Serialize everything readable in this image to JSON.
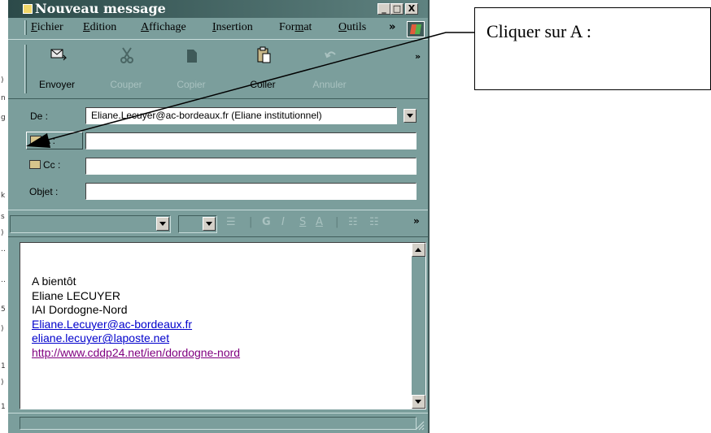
{
  "window": {
    "title": "Nouveau message",
    "controls": {
      "minimize": "_",
      "maximize": "□",
      "close": "X"
    }
  },
  "menubar": {
    "items": [
      {
        "label": "Fichier",
        "mnemonic": "F"
      },
      {
        "label": "Edition",
        "mnemonic": "E"
      },
      {
        "label": "Affichage",
        "mnemonic": "A"
      },
      {
        "label": "Insertion",
        "mnemonic": "I"
      },
      {
        "label": "Format",
        "mnemonic": "m"
      },
      {
        "label": "Outils",
        "mnemonic": "O"
      }
    ],
    "overflow": "»"
  },
  "toolbar": {
    "buttons": [
      {
        "label": "Envoyer",
        "icon": "send-icon",
        "enabled": true
      },
      {
        "label": "Couper",
        "icon": "scissors-icon",
        "enabled": false
      },
      {
        "label": "Copier",
        "icon": "copy-icon",
        "enabled": false
      },
      {
        "label": "Coller",
        "icon": "paste-icon",
        "enabled": true
      },
      {
        "label": "Annuler",
        "icon": "undo-icon",
        "enabled": false
      }
    ],
    "overflow": "»"
  },
  "header": {
    "from_label": "De :",
    "from_value": "Eliane.Lecuyer@ac-bordeaux.fr    (Eliane institutionnel)",
    "to_label": "A :",
    "to_value": "",
    "cc_label": "Cc :",
    "cc_value": "",
    "subject_label": "Objet :",
    "subject_value": ""
  },
  "format_toolbar": {
    "font_name": "",
    "font_size": "",
    "overflow": "»",
    "icons": [
      "paragraph-style-icon",
      "bold-icon",
      "italic-icon",
      "underline-icon",
      "font-color-icon",
      "numbered-list-icon",
      "bullet-list-icon"
    ]
  },
  "message_body": {
    "lines": [
      {
        "text": "A bientôt",
        "kind": "text"
      },
      {
        "text": "Eliane LECUYER",
        "kind": "text"
      },
      {
        "text": "IAI Dordogne-Nord",
        "kind": "text"
      },
      {
        "text": "Eliane.Lecuyer@ac-bordeaux.fr",
        "kind": "link"
      },
      {
        "text": "eliane.lecuyer@laposte.net",
        "kind": "link"
      },
      {
        "text": "http://www.cddp24.net/ien/dordogne-nord",
        "kind": "visited-link"
      }
    ]
  },
  "annotation": {
    "callout_text": "Cliquer sur A :"
  },
  "colors": {
    "window_bg": "#7b9e9c",
    "titlebar": "#2c4a49",
    "link": "#0000cc",
    "visited_link": "#800080"
  }
}
